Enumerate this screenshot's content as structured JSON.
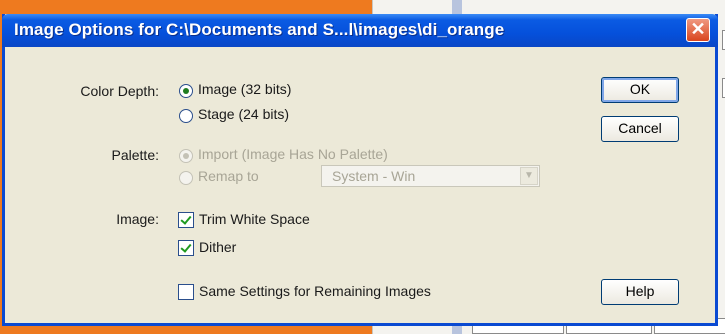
{
  "dialog": {
    "title": "Image Options for C:\\Documents and S...l\\images\\di_orange",
    "close_glyph": "✕"
  },
  "color_depth": {
    "label": "Color Depth:",
    "options": [
      {
        "label": "Image (32 bits)",
        "selected": true
      },
      {
        "label": "Stage (24 bits)",
        "selected": false
      }
    ]
  },
  "palette": {
    "label": "Palette:",
    "import_label": "Import (Image Has No Palette)",
    "remap_label": "Remap to",
    "select_value": "System - Win",
    "enabled": false
  },
  "image": {
    "label": "Image:",
    "trim_label": "Trim White Space",
    "trim_checked": true,
    "dither_label": "Dither",
    "dither_checked": true
  },
  "same_settings": {
    "label": "Same Settings for Remaining Images",
    "checked": false
  },
  "buttons": {
    "ok": "OK",
    "cancel": "Cancel",
    "help": "Help"
  },
  "colors": {
    "titlebar": "#0550db",
    "dialog_bg": "#ece9d8",
    "app_bg_orange": "#ee7a1f"
  }
}
